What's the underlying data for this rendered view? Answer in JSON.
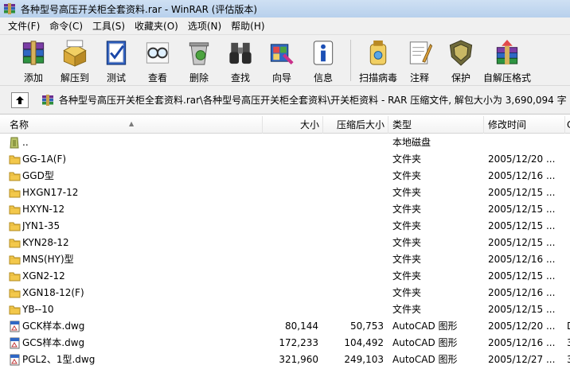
{
  "window": {
    "title": "各种型号高压开关柜全套资料.rar - WinRAR (评估版本)"
  },
  "menu": [
    {
      "label": "文件(F)"
    },
    {
      "label": "命令(C)"
    },
    {
      "label": "工具(S)"
    },
    {
      "label": "收藏夹(O)"
    },
    {
      "label": "选项(N)"
    },
    {
      "label": "帮助(H)"
    }
  ],
  "toolbar": [
    {
      "label": "添加",
      "icon": "add-books-icon"
    },
    {
      "label": "解压到",
      "icon": "extract-to-icon"
    },
    {
      "label": "测试",
      "icon": "test-icon"
    },
    {
      "label": "查看",
      "icon": "view-glasses-icon"
    },
    {
      "label": "删除",
      "icon": "delete-icon"
    },
    {
      "label": "查找",
      "icon": "find-binoculars-icon"
    },
    {
      "label": "向导",
      "icon": "wizard-icon"
    },
    {
      "label": "信息",
      "icon": "info-icon"
    },
    {
      "label": "扫描病毒",
      "icon": "virus-scan-icon"
    },
    {
      "label": "注释",
      "icon": "comment-icon"
    },
    {
      "label": "保护",
      "icon": "protect-shield-icon"
    },
    {
      "label": "自解压格式",
      "icon": "sfx-icon"
    }
  ],
  "path": {
    "text": "各种型号高压开关柜全套资料.rar\\各种型号高压开关柜全套资料\\开关柜资料 - RAR 压缩文件, 解包大小为 3,690,094 字"
  },
  "columns": {
    "name": "名称",
    "size": "大小",
    "packed": "压缩后大小",
    "type": "类型",
    "modified": "修改时间",
    "extra": "C"
  },
  "files": [
    {
      "icon": "parent-folder",
      "name": "..",
      "size": "",
      "packed": "",
      "type": "本地磁盘",
      "modified": "",
      "extra": ""
    },
    {
      "icon": "folder",
      "name": "GG-1A(F)",
      "size": "",
      "packed": "",
      "type": "文件夹",
      "modified": "2005/12/20 ...",
      "extra": ""
    },
    {
      "icon": "folder",
      "name": "GGD型",
      "size": "",
      "packed": "",
      "type": "文件夹",
      "modified": "2005/12/16 ...",
      "extra": ""
    },
    {
      "icon": "folder",
      "name": "HXGN17-12",
      "size": "",
      "packed": "",
      "type": "文件夹",
      "modified": "2005/12/15 ...",
      "extra": ""
    },
    {
      "icon": "folder",
      "name": "HXYN-12",
      "size": "",
      "packed": "",
      "type": "文件夹",
      "modified": "2005/12/15 ...",
      "extra": ""
    },
    {
      "icon": "folder",
      "name": "JYN1-35",
      "size": "",
      "packed": "",
      "type": "文件夹",
      "modified": "2005/12/15 ...",
      "extra": ""
    },
    {
      "icon": "folder",
      "name": "KYN28-12",
      "size": "",
      "packed": "",
      "type": "文件夹",
      "modified": "2005/12/15 ...",
      "extra": ""
    },
    {
      "icon": "folder",
      "name": "MNS(HY)型",
      "size": "",
      "packed": "",
      "type": "文件夹",
      "modified": "2005/12/16 ...",
      "extra": ""
    },
    {
      "icon": "folder",
      "name": "XGN2-12",
      "size": "",
      "packed": "",
      "type": "文件夹",
      "modified": "2005/12/15 ...",
      "extra": ""
    },
    {
      "icon": "folder",
      "name": "XGN18-12(F)",
      "size": "",
      "packed": "",
      "type": "文件夹",
      "modified": "2005/12/16 ...",
      "extra": ""
    },
    {
      "icon": "folder",
      "name": "YB--10",
      "size": "",
      "packed": "",
      "type": "文件夹",
      "modified": "2005/12/15 ...",
      "extra": ""
    },
    {
      "icon": "dwg-file",
      "name": "GCK样本.dwg",
      "size": "80,144",
      "packed": "50,753",
      "type": "AutoCAD 图形",
      "modified": "2005/12/20 ...",
      "extra": "D"
    },
    {
      "icon": "dwg-file",
      "name": "GCS样本.dwg",
      "size": "172,233",
      "packed": "104,492",
      "type": "AutoCAD 图形",
      "modified": "2005/12/16 ...",
      "extra": "3"
    },
    {
      "icon": "dwg-file",
      "name": "PGL2、1型.dwg",
      "size": "321,960",
      "packed": "249,103",
      "type": "AutoCAD 图形",
      "modified": "2005/12/27 ...",
      "extra": "3"
    }
  ],
  "colors": {
    "title_bg": "#b7d0ec",
    "folder_yellow": "#f3c84b"
  }
}
